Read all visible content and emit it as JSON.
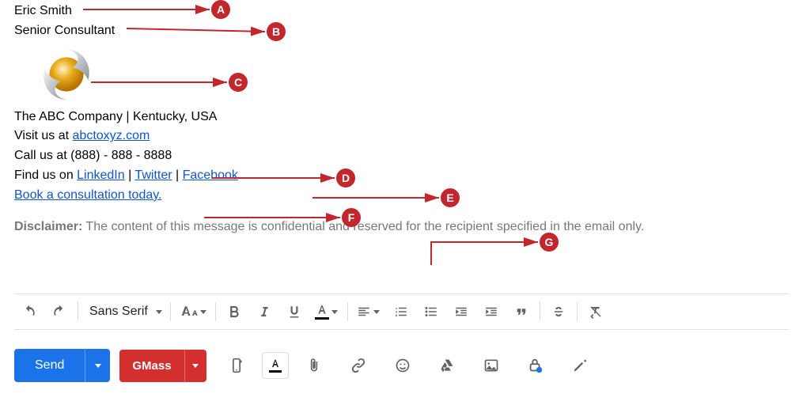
{
  "signature": {
    "name": "Eric Smith",
    "title": "Senior Consultant",
    "company_line": "The ABC Company | Kentucky, USA",
    "visit_label": "Visit us at ",
    "visit_link": "abctoxyz.com",
    "call_line": "Call us at (888) - 888 - 8888",
    "find_label": "Find us on ",
    "social": {
      "linkedin": "LinkedIn",
      "twitter": "Twitter",
      "facebook": "Facebook"
    },
    "cta": "Book a consultation today.",
    "disclaimer_label": "Disclaimer:",
    "disclaimer_text": " The content of this message is confidential and reserved for the recipient specified in the email only."
  },
  "annotations": {
    "a": "A",
    "b": "B",
    "c": "C",
    "d": "D",
    "e": "E",
    "f": "F",
    "g": "G"
  },
  "toolbar": {
    "font": "Sans Serif"
  },
  "actions": {
    "send": "Send",
    "gmass": "GMass"
  },
  "colors": {
    "link": "#1155cc",
    "accent_blue": "#1a73e8",
    "accent_red": "#d32f2f",
    "badge": "#c1272d",
    "icon": "#5f6368"
  },
  "chart_data": null
}
